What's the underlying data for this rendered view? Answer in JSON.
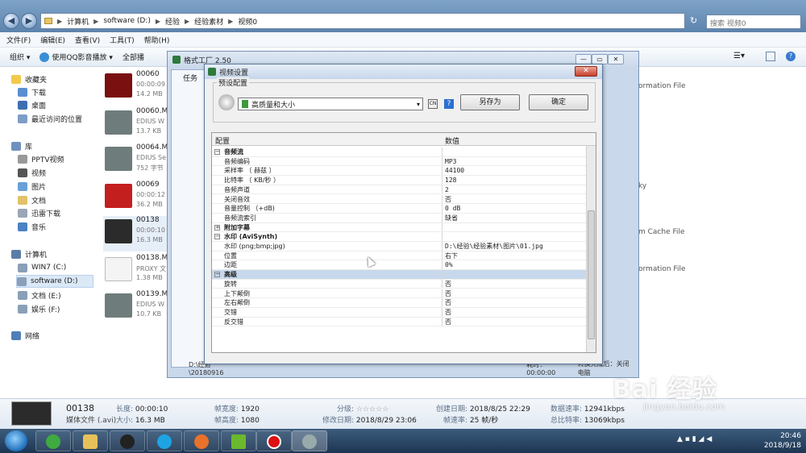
{
  "explorer": {
    "address": [
      "计算机",
      "software (D:)",
      "经验",
      "经验素材",
      "视频0"
    ],
    "search_placeholder": "搜索 视频0",
    "menu": [
      "文件(F)",
      "编辑(E)",
      "查看(V)",
      "工具(T)",
      "帮助(H)"
    ],
    "toolbar": [
      "组织 ▾",
      "使用QQ影音播放 ▾",
      "全部播"
    ],
    "nav": {
      "favorites": "收藏夹",
      "fav_items": [
        "下载",
        "桌面",
        "最近访问的位置"
      ],
      "library": "库",
      "lib_items": [
        "PPTV视频",
        "视频",
        "图片",
        "文档",
        "迅雷下载",
        "音乐"
      ],
      "computer": "计算机",
      "drives": [
        "WIN7 (C:)",
        "software (D:)",
        "文档 (E:)",
        "娱乐 (F:)"
      ],
      "network": "网络"
    },
    "files": [
      {
        "name": "00060",
        "sub": "00:00:09",
        "size": "14.2 MB"
      },
      {
        "name": "00060.MT",
        "sub": "EDIUS W",
        "size": "13.7 KB"
      },
      {
        "name": "00064.MT",
        "sub": "EDIUS Se",
        "size": "752 字节"
      },
      {
        "name": "00069",
        "sub": "00:00:12",
        "size": "36.2 MB"
      },
      {
        "name": "00138",
        "sub": "00:00:10",
        "size": "16.3 MB"
      },
      {
        "name": "00138.MT",
        "sub": "PROXY 文",
        "size": "1.38 MB"
      },
      {
        "name": "00139.MT",
        "sub": "EDIUS W",
        "size": "10.7 KB"
      }
    ],
    "right_texts": [
      "ormation File",
      "ky",
      "m Cache File",
      "ormation File"
    ]
  },
  "ff": {
    "title": "格式工厂 2.50",
    "task_label": "任务",
    "status_path": "D:\\经验\\20180916",
    "status_time": "耗时：00:00:00",
    "status_after": "转换完成后：关闭电脑"
  },
  "dialog": {
    "title": "视频设置",
    "preset_group": "预设配置",
    "preset_value": "高质量和大小",
    "save_as": "另存为",
    "ok": "确定",
    "col_config": "配置",
    "col_value": "数值",
    "rows": [
      {
        "k": "音频流",
        "v": "",
        "cat": true,
        "tog": "−"
      },
      {
        "k": "音频编码",
        "v": "MP3"
      },
      {
        "k": "采样率 （ 赫兹 ）",
        "v": "44100"
      },
      {
        "k": "比特率 （ KB/秒 ）",
        "v": "128"
      },
      {
        "k": "音频声道",
        "v": "2"
      },
      {
        "k": "关闭音效",
        "v": "否"
      },
      {
        "k": "音量控制 （+dB)",
        "v": "0 dB"
      },
      {
        "k": "音频流索引",
        "v": "缺省"
      },
      {
        "k": "附加字幕",
        "v": "",
        "cat": true,
        "tog": "+"
      },
      {
        "k": "水印 (AviSynth)",
        "v": "",
        "cat": true,
        "tog": "−"
      },
      {
        "k": "水印 (png;bmp;jpg)",
        "v": "D:\\经验\\经验素材\\图片\\01.jpg"
      },
      {
        "k": "位置",
        "v": "右下"
      },
      {
        "k": "边距",
        "v": "0%"
      },
      {
        "k": "高级",
        "v": "",
        "cat": true,
        "tog": "−",
        "hl": true
      },
      {
        "k": "旋转",
        "v": "否"
      },
      {
        "k": "上下颠倒",
        "v": "否"
      },
      {
        "k": "左右颠倒",
        "v": "否"
      },
      {
        "k": "交错",
        "v": "否"
      },
      {
        "k": "反交错",
        "v": "否"
      }
    ]
  },
  "details": {
    "name": "00138",
    "type": "媒体文件 (.avi)",
    "length_l": "长度:",
    "length_v": "00:00:10",
    "size_l": "大小:",
    "size_v": "16.3 MB",
    "fw_l": "帧宽度:",
    "fw_v": "1920",
    "fh_l": "帧高度:",
    "fh_v": "1080",
    "rating_l": "分级:",
    "rating_v": "☆☆☆☆☆",
    "mod_l": "修改日期:",
    "mod_v": "2018/8/29 23:06",
    "created_l": "创建日期:",
    "created_v": "2018/8/25 22:29",
    "fps_l": "帧速率:",
    "fps_v": "25 帧/秒",
    "rate_l": "数据速率:",
    "rate_v": "12941kbps",
    "br_l": "总比特率:",
    "br_v": "13069kbps"
  },
  "taskbar": {
    "time": "20:46",
    "date": "2018/9/18"
  },
  "watermark": {
    "logo": "Bai 经验",
    "url": "jingyan.baidu.com"
  }
}
